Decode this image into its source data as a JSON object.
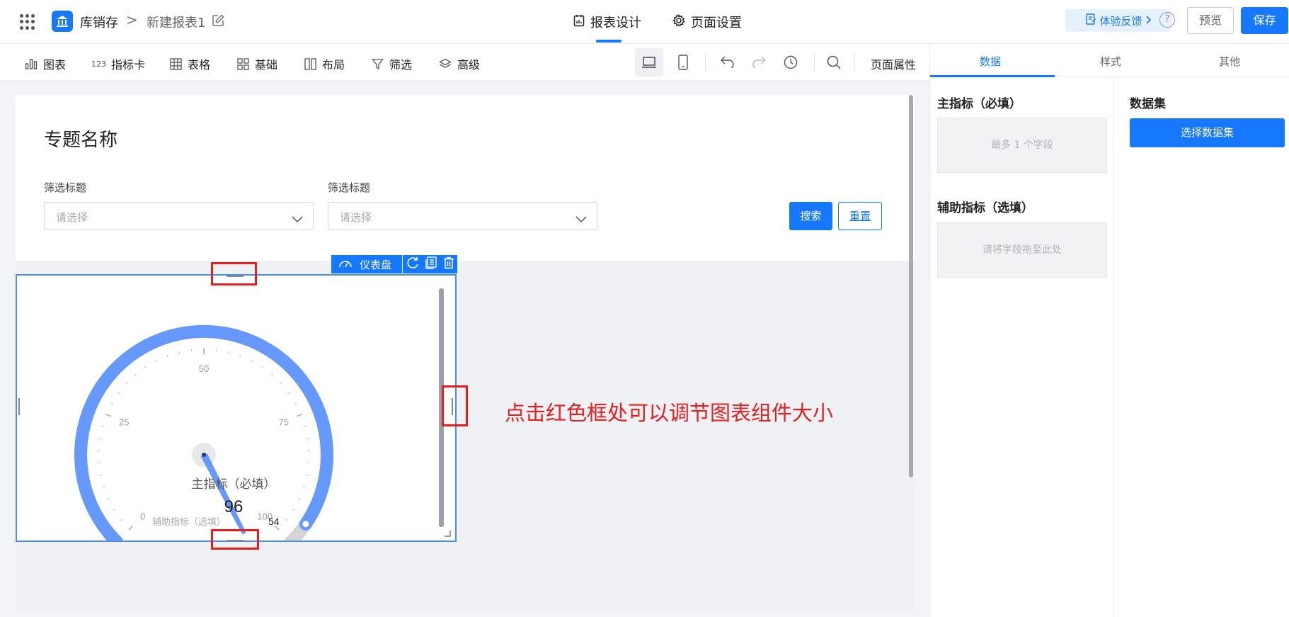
{
  "header": {
    "app_name": "库销存",
    "breadcrumb_sep": ">",
    "report_name": "新建报表1",
    "tabs": [
      {
        "label": "报表设计",
        "icon": "report-design-icon",
        "active": true
      },
      {
        "label": "页面设置",
        "icon": "gear-icon",
        "active": false
      }
    ],
    "feedback_label": "体验反馈",
    "help_glyph": "?",
    "preview_label": "预览",
    "save_label": "保存",
    "accent_color": "#1677ff"
  },
  "toolbar": {
    "items": [
      {
        "label": "图表",
        "icon": "bar-chart-icon"
      },
      {
        "label": "指标卡",
        "icon": "metric-card-icon",
        "icon_text": "123"
      },
      {
        "label": "表格",
        "icon": "table-icon"
      },
      {
        "label": "基础",
        "icon": "basic-grid-icon"
      },
      {
        "label": "布局",
        "icon": "layout-icon"
      },
      {
        "label": "筛选",
        "icon": "filter-icon"
      },
      {
        "label": "高级",
        "icon": "layers-icon"
      }
    ],
    "page_attr_label": "页面属性"
  },
  "canvas": {
    "topic_title": "专题名称",
    "filters": [
      {
        "label": "筛选标题",
        "placeholder": "请选择"
      },
      {
        "label": "筛选标题",
        "placeholder": "请选择"
      }
    ],
    "search_label": "搜索",
    "reset_label": "重置"
  },
  "widget": {
    "type_label": "仪表盘",
    "gauge": {
      "min": 0,
      "max": 100,
      "value": 96,
      "tick_labels": [
        "0",
        "25",
        "50",
        "75",
        "100"
      ],
      "main_label": "主指标（必填）",
      "value_label": "96",
      "sub_label": "辅助指标（选填）",
      "sub_value": "54",
      "arc_color": "#6699ff",
      "track_color": "#d4d4d4",
      "needle_color": "#6699ff"
    },
    "annotation": "点击红色框处可以调节图表组件大小",
    "annotation_color": "#e61e1e"
  },
  "right_panel": {
    "tabs": [
      {
        "label": "数据",
        "active": true
      },
      {
        "label": "样式",
        "active": false
      },
      {
        "label": "其他",
        "active": false
      }
    ],
    "main_metric": {
      "title": "主指标（必填）",
      "hint": "最多 1 个字段"
    },
    "aux_metric": {
      "title": "辅助指标（选填）",
      "hint": "请将字段拖至此处"
    },
    "dataset": {
      "title": "数据集",
      "button_label": "选择数据集"
    }
  }
}
